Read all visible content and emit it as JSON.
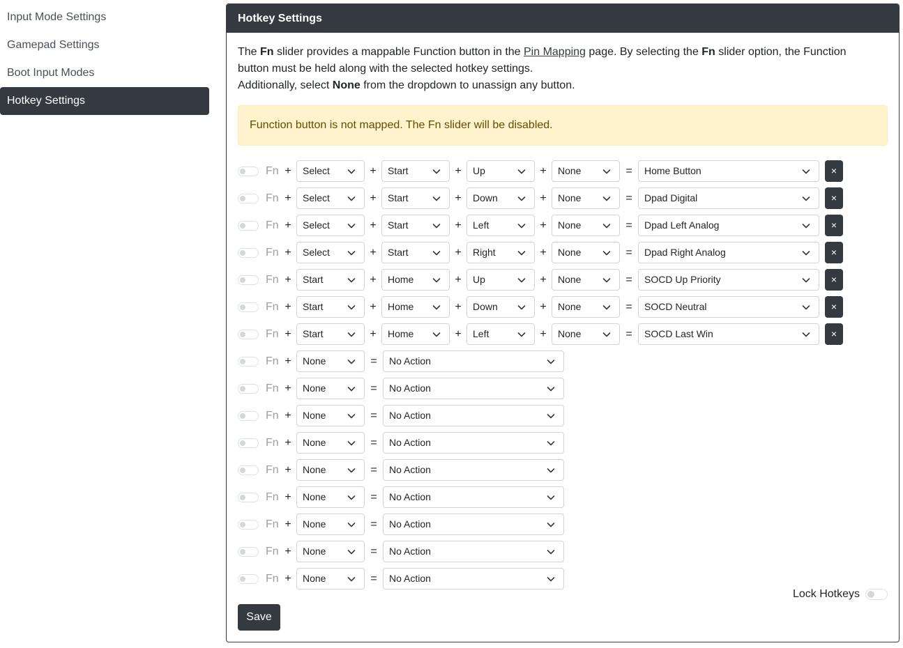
{
  "sidebar": {
    "items": [
      {
        "label": "Input Mode Settings",
        "active": false
      },
      {
        "label": "Gamepad Settings",
        "active": false
      },
      {
        "label": "Boot Input Modes",
        "active": false
      },
      {
        "label": "Hotkey Settings",
        "active": true
      }
    ]
  },
  "card": {
    "title": "Hotkey Settings",
    "description": {
      "part1": "The ",
      "fn1": "Fn",
      "part2": " slider provides a mappable Function button in the ",
      "link": "Pin Mapping",
      "part3": " page. By selecting the ",
      "fn2": "Fn",
      "part4": " slider option, the Function button must be held along with the selected hotkey settings.",
      "part5": "Additionally, select ",
      "none": "None",
      "part6": " from the dropdown to unassign any button."
    },
    "alert": "Function button is not mapped. The Fn slider will be disabled."
  },
  "fn_label": "Fn",
  "plus": "+",
  "equals": "=",
  "remove_label": "×",
  "hotkeys": [
    {
      "buttons": [
        "Select",
        "Start",
        "Up",
        "None"
      ],
      "action": "Home Button"
    },
    {
      "buttons": [
        "Select",
        "Start",
        "Down",
        "None"
      ],
      "action": "Dpad Digital"
    },
    {
      "buttons": [
        "Select",
        "Start",
        "Left",
        "None"
      ],
      "action": "Dpad Left Analog"
    },
    {
      "buttons": [
        "Select",
        "Start",
        "Right",
        "None"
      ],
      "action": "Dpad Right Analog"
    },
    {
      "buttons": [
        "Start",
        "Home",
        "Up",
        "None"
      ],
      "action": "SOCD Up Priority"
    },
    {
      "buttons": [
        "Start",
        "Home",
        "Down",
        "None"
      ],
      "action": "SOCD Neutral"
    },
    {
      "buttons": [
        "Start",
        "Home",
        "Left",
        "None"
      ],
      "action": "SOCD Last Win"
    },
    {
      "buttons": [
        "None"
      ],
      "action": "No Action"
    },
    {
      "buttons": [
        "None"
      ],
      "action": "No Action"
    },
    {
      "buttons": [
        "None"
      ],
      "action": "No Action"
    },
    {
      "buttons": [
        "None"
      ],
      "action": "No Action"
    },
    {
      "buttons": [
        "None"
      ],
      "action": "No Action"
    },
    {
      "buttons": [
        "None"
      ],
      "action": "No Action"
    },
    {
      "buttons": [
        "None"
      ],
      "action": "No Action"
    },
    {
      "buttons": [
        "None"
      ],
      "action": "No Action"
    },
    {
      "buttons": [
        "None"
      ],
      "action": "No Action"
    }
  ],
  "lock_hotkeys_label": "Lock Hotkeys",
  "save_label": "Save",
  "colors": {
    "dark": "#343a40",
    "alert_bg": "#fff3cd",
    "alert_text": "#664d03"
  }
}
